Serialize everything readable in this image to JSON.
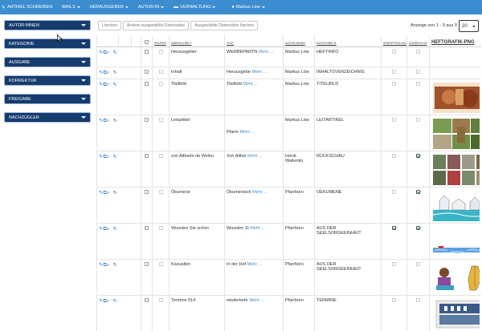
{
  "nav": {
    "items": [
      {
        "label": "ARTIKEL SCHREIBEN",
        "icon": "pencil-icon",
        "caret": false
      },
      {
        "label": "MAILS",
        "icon": "",
        "caret": true
      },
      {
        "label": "HERAUSGEBER",
        "icon": "",
        "caret": true
      },
      {
        "label": "AUTOR:IN",
        "icon": "",
        "caret": true
      },
      {
        "label": "VERWALTUNG",
        "icon": "folder-icon",
        "caret": true
      },
      {
        "label": "Markus Löw",
        "icon": "user-icon",
        "caret": true
      }
    ],
    "color": "#3c8dd0"
  },
  "sidebar": {
    "items": [
      {
        "label": "AUTOR:INNEN"
      },
      {
        "label": "KATEGORIE"
      },
      {
        "label": "AUSGABE"
      },
      {
        "label": "KORREKTUR"
      },
      {
        "label": "FREIGABE"
      },
      {
        "label": "NACHZÜGLER"
      }
    ],
    "color": "#163b6e"
  },
  "toolbar": {
    "delete_label": "Löschen",
    "change_label": "Ändere ausgewählte Datensätze",
    "delete_selected_label": "Ausgewählte Datensätze löschen"
  },
  "pagination": {
    "count_text": "Anzeige von 1 - 9 aus 9",
    "page_size": "20"
  },
  "table": {
    "headers": {
      "pruefen": "PRÜFEN",
      "ueberschrift": "ÜBERSCHRIFT",
      "text": "TEXT",
      "autor": "AUTOR:INNEN",
      "kategorie": "KATEGORIE ⇅",
      "veroeffentlicht": "VERÖFFENTLICHT",
      "korrektur": "KORREKTUR",
      "heftgrafik": "HEFTGRAFIK-PNG"
    },
    "more_label": "Mehr ...",
    "rows": [
      {
        "ueberschrift": "Herausgeber",
        "text": "WERBEPARTN",
        "autor": "Markus Löw",
        "kategorie": "HEFTINFO",
        "veroeffentlicht": false,
        "korrektur": false,
        "image": ""
      },
      {
        "ueberschrift": "Inhalt",
        "text": "Herausgebe",
        "autor": "Markus Löw",
        "kategorie": "INHALTSVERZEICHNIS",
        "veroeffentlicht": false,
        "korrektur": false,
        "image": ""
      },
      {
        "ueberschrift": "Titelbild",
        "text": "Titelbild",
        "autor": "Markus Löw",
        "kategorie": "TITELBILD",
        "veroeffentlicht": false,
        "korrektur": false,
        "image": "titelbild"
      },
      {
        "ueberschrift": "Leitartikel",
        "text": "Pfarre",
        "autor": "Markus Löw",
        "kategorie": "LEITARTIKEL",
        "veroeffentlicht": false,
        "korrektur": false,
        "image": "leitartikel"
      },
      {
        "ueberschrift": "von Altheim ob Weihu",
        "text": "Von Althei",
        "autor": "Hordi: Wallentin",
        "kategorie": "RÜCKSCHAU",
        "veroeffentlicht": false,
        "korrektur": true,
        "image": "rueckschau"
      },
      {
        "ueberschrift": "Ökumene",
        "text": "Ökumenisch",
        "autor": "Pfarrbüro",
        "kategorie": "OEKUMENE",
        "veroeffentlicht": false,
        "korrektur": true,
        "image": "oekumene"
      },
      {
        "ueberschrift": "Wussten Sie schon",
        "text": "Wussten Si",
        "autor": "Pfarrbüro",
        "kategorie": "AUS DER SEELSORGEEINHEIT",
        "veroeffentlicht": true,
        "korrektur": true,
        "image": "wussten"
      },
      {
        "ueberschrift": "Kasualien",
        "text": "In der Hof",
        "autor": "Pfarrbüro",
        "kategorie": "AUS DER SEELSORGEEINHEIT",
        "veroeffentlicht": false,
        "korrektur": false,
        "image": "kasualien"
      },
      {
        "ueberschrift": "Termine 514",
        "text": "wiederkehr",
        "autor": "Pfarrbüro",
        "kategorie": "TERMINE",
        "veroeffentlicht": false,
        "korrektur": false,
        "image": "termine"
      }
    ]
  }
}
